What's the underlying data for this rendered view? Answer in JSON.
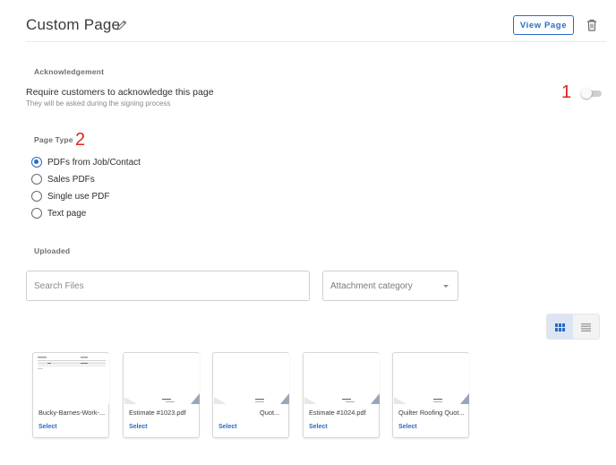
{
  "header": {
    "title": "Custom Page",
    "view_page_label": "View Page"
  },
  "acknowledgement": {
    "section_label": "Acknowledgement",
    "title": "Require customers to acknowledge this page",
    "subtitle": "They will be asked during the signing process",
    "enabled": false,
    "marker": "1"
  },
  "page_type": {
    "section_label": "Page Type",
    "marker": "2",
    "options": [
      {
        "label": "PDFs from Job/Contact",
        "checked": true
      },
      {
        "label": "Sales PDFs",
        "checked": false
      },
      {
        "label": "Single use PDF",
        "checked": false
      },
      {
        "label": "Text page",
        "checked": false
      }
    ]
  },
  "uploaded": {
    "section_label": "Uploaded",
    "search_placeholder": "Search Files",
    "category_placeholder": "Attachment category",
    "view_mode": "grid",
    "select_label": "Select",
    "files": [
      {
        "name": "Bucky-Barnes-Work-..."
      },
      {
        "name": "Estimate #1023.pdf"
      },
      {
        "name": "Quot..."
      },
      {
        "name": "Estimate #1024.pdf"
      },
      {
        "name": "Quilter Roofing Quot..."
      }
    ]
  },
  "colors": {
    "accent": "#2a6bc4",
    "marker": "#e0241b"
  }
}
